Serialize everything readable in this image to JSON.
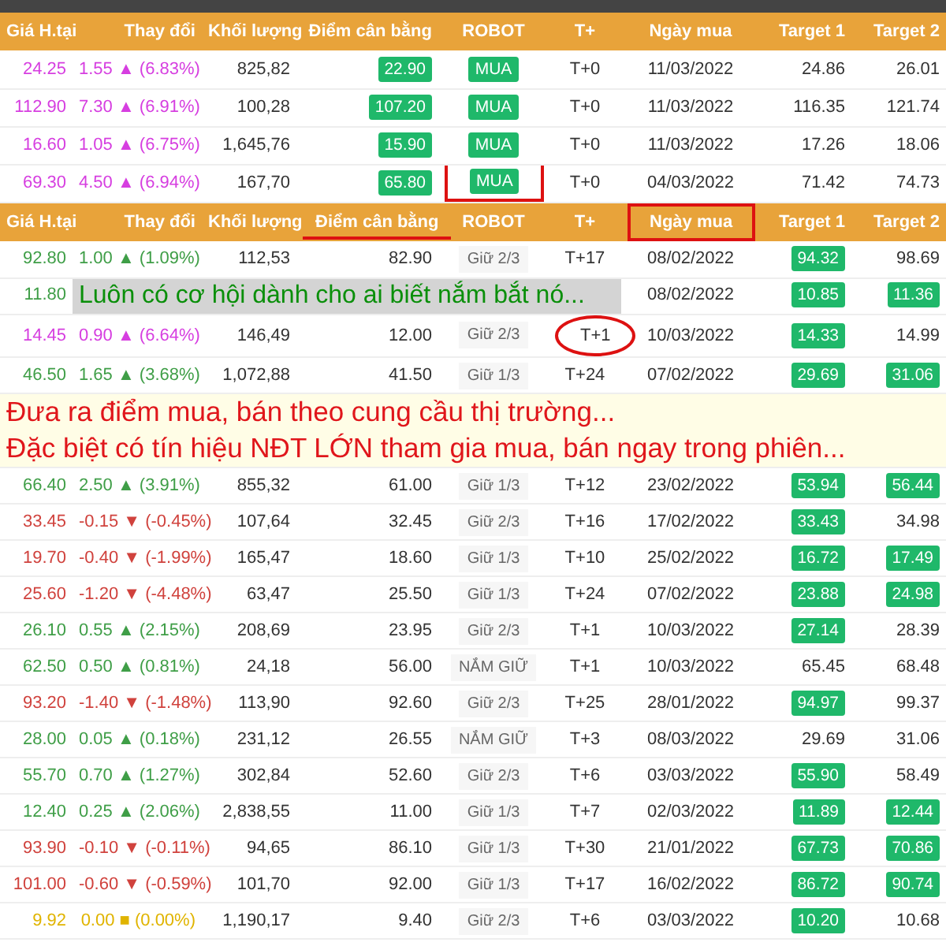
{
  "top_table": {
    "columns": [
      {
        "label": "Giá H.tại",
        "underlined": false,
        "boxed": false
      },
      {
        "label": "Thay đổi",
        "underlined": false,
        "boxed": false
      },
      {
        "label": "Khối lượng",
        "underlined": false,
        "boxed": false
      },
      {
        "label": "Điểm cân bằng",
        "underlined": false,
        "boxed": false
      },
      {
        "label": "ROBOT",
        "underlined": false,
        "boxed": false
      },
      {
        "label": "T+",
        "underlined": false,
        "boxed": false
      },
      {
        "label": "Ngày mua",
        "underlined": false,
        "boxed": false
      },
      {
        "label": "Target 1",
        "underlined": false,
        "boxed": false
      },
      {
        "label": "Target 2",
        "underlined": false,
        "boxed": false
      }
    ],
    "rows": [
      {
        "kind": "stock",
        "color": "#d63ee0",
        "price": "24.25",
        "change": "1.55 ▲ (6.83%)",
        "volume": "825,82",
        "balance": "22.90",
        "balance_hit": true,
        "robot": "MUA",
        "robot_highlighted": true,
        "robot_bracketed": false,
        "tplus": "T+0",
        "tplus_circled": false,
        "date": "11/03/2022",
        "target1": "24.86",
        "target1_hit": false,
        "target2": "26.01",
        "target2_hit": false
      },
      {
        "kind": "stock",
        "color": "#d63ee0",
        "price": "112.90",
        "change": "7.30 ▲ (6.91%)",
        "volume": "100,28",
        "balance": "107.20",
        "balance_hit": true,
        "robot": "MUA",
        "robot_highlighted": true,
        "robot_bracketed": false,
        "tplus": "T+0",
        "tplus_circled": false,
        "date": "11/03/2022",
        "target1": "116.35",
        "target1_hit": false,
        "target2": "121.74",
        "target2_hit": false
      },
      {
        "kind": "stock",
        "color": "#d63ee0",
        "price": "16.60",
        "change": "1.05 ▲ (6.75%)",
        "volume": "1,645,76",
        "balance": "15.90",
        "balance_hit": true,
        "robot": "MUA",
        "robot_highlighted": true,
        "robot_bracketed": false,
        "tplus": "T+0",
        "tplus_circled": false,
        "date": "11/03/2022",
        "target1": "17.26",
        "target1_hit": false,
        "target2": "18.06",
        "target2_hit": false
      },
      {
        "kind": "stock",
        "color": "#d63ee0",
        "price": "69.30",
        "change": "4.50 ▲ (6.94%)",
        "volume": "167,70",
        "balance": "65.80",
        "balance_hit": true,
        "robot": "MUA",
        "robot_highlighted": true,
        "robot_bracketed": true,
        "tplus": "T+0",
        "tplus_circled": false,
        "date": "04/03/2022",
        "target1": "71.42",
        "target1_hit": false,
        "target2": "74.73",
        "target2_hit": false
      }
    ]
  },
  "bottom_table": {
    "columns": [
      {
        "label": "Giá H.tại",
        "underlined": false,
        "boxed": false
      },
      {
        "label": "Thay đổi",
        "underlined": false,
        "boxed": false
      },
      {
        "label": "Khối lượng",
        "underlined": false,
        "boxed": false
      },
      {
        "label": "Điểm cân bằng",
        "underlined": true,
        "boxed": false
      },
      {
        "label": "ROBOT",
        "underlined": false,
        "boxed": false
      },
      {
        "label": "T+",
        "underlined": false,
        "boxed": false
      },
      {
        "label": "Ngày mua",
        "underlined": false,
        "boxed": true
      },
      {
        "label": "Target 1",
        "underlined": false,
        "boxed": false
      },
      {
        "label": "Target 2",
        "underlined": false,
        "boxed": false
      }
    ],
    "rows": [
      {
        "kind": "stock",
        "color": "#3f9e47",
        "price": "92.80",
        "change": "1.00 ▲ (1.09%)",
        "volume": "112,53",
        "balance": "82.90",
        "balance_hit": false,
        "robot": "Giữ 2/3",
        "robot_highlighted": false,
        "robot_bracketed": false,
        "tplus": "T+17",
        "tplus_circled": false,
        "date": "08/02/2022",
        "target1": "94.32",
        "target1_hit": true,
        "target2": "98.69",
        "target2_hit": false
      },
      {
        "kind": "covered",
        "color": "#3f9e47",
        "price": "11.80",
        "note": "Luôn có cơ hội dành cho ai biết nắm bắt nó...",
        "date": "08/02/2022",
        "target1": "10.85",
        "target1_hit": true,
        "target2": "11.36",
        "target2_hit": true
      },
      {
        "kind": "stock",
        "color": "#d63ee0",
        "price": "14.45",
        "change": "0.90 ▲ (6.64%)",
        "volume": "146,49",
        "balance": "12.00",
        "balance_hit": false,
        "robot": "Giữ 2/3",
        "robot_highlighted": false,
        "robot_bracketed": false,
        "tplus": "T+1",
        "tplus_circled": true,
        "date": "10/03/2022",
        "target1": "14.33",
        "target1_hit": true,
        "target2": "14.99",
        "target2_hit": false
      },
      {
        "kind": "stock",
        "color": "#3f9e47",
        "price": "46.50",
        "change": "1.65 ▲ (3.68%)",
        "volume": "1,072,88",
        "balance": "41.50",
        "balance_hit": false,
        "robot": "Giữ 1/3",
        "robot_highlighted": false,
        "robot_bracketed": false,
        "tplus": "T+24",
        "tplus_circled": false,
        "date": "07/02/2022",
        "target1": "29.69",
        "target1_hit": true,
        "target2": "31.06",
        "target2_hit": true
      },
      {
        "kind": "note",
        "lines": [
          "Đưa ra điểm mua, bán theo cung cầu thị trường...",
          "Đặc biệt có tín hiệu NĐT LỚN tham gia mua, bán ngay trong phiên..."
        ]
      },
      {
        "kind": "stock",
        "color": "#3f9e47",
        "price": "66.40",
        "change": "2.50 ▲ (3.91%)",
        "volume": "855,32",
        "balance": "61.00",
        "balance_hit": false,
        "robot": "Giữ 1/3",
        "robot_highlighted": false,
        "robot_bracketed": false,
        "tplus": "T+12",
        "tplus_circled": false,
        "date": "23/02/2022",
        "target1": "53.94",
        "target1_hit": true,
        "target2": "56.44",
        "target2_hit": true
      },
      {
        "kind": "stock",
        "color": "#d0423d",
        "price": "33.45",
        "change": "-0.15 ▼ (-0.45%)",
        "volume": "107,64",
        "balance": "32.45",
        "balance_hit": false,
        "robot": "Giữ 2/3",
        "robot_highlighted": false,
        "robot_bracketed": false,
        "tplus": "T+16",
        "tplus_circled": false,
        "date": "17/02/2022",
        "target1": "33.43",
        "target1_hit": true,
        "target2": "34.98",
        "target2_hit": false
      },
      {
        "kind": "stock",
        "color": "#d0423d",
        "price": "19.70",
        "change": "-0.40 ▼ (-1.99%)",
        "volume": "165,47",
        "balance": "18.60",
        "balance_hit": false,
        "robot": "Giữ 1/3",
        "robot_highlighted": false,
        "robot_bracketed": false,
        "tplus": "T+10",
        "tplus_circled": false,
        "date": "25/02/2022",
        "target1": "16.72",
        "target1_hit": true,
        "target2": "17.49",
        "target2_hit": true
      },
      {
        "kind": "stock",
        "color": "#d0423d",
        "price": "25.60",
        "change": "-1.20 ▼ (-4.48%)",
        "volume": "63,47",
        "balance": "25.50",
        "balance_hit": false,
        "robot": "Giữ 1/3",
        "robot_highlighted": false,
        "robot_bracketed": false,
        "tplus": "T+24",
        "tplus_circled": false,
        "date": "07/02/2022",
        "target1": "23.88",
        "target1_hit": true,
        "target2": "24.98",
        "target2_hit": true
      },
      {
        "kind": "stock",
        "color": "#3f9e47",
        "price": "26.10",
        "change": "0.55 ▲ (2.15%)",
        "volume": "208,69",
        "balance": "23.95",
        "balance_hit": false,
        "robot": "Giữ 2/3",
        "robot_highlighted": false,
        "robot_bracketed": false,
        "tplus": "T+1",
        "tplus_circled": false,
        "date": "10/03/2022",
        "target1": "27.14",
        "target1_hit": true,
        "target2": "28.39",
        "target2_hit": false
      },
      {
        "kind": "stock",
        "color": "#3f9e47",
        "price": "62.50",
        "change": "0.50 ▲ (0.81%)",
        "volume": "24,18",
        "balance": "56.00",
        "balance_hit": false,
        "robot": "NẮM GIỮ",
        "robot_highlighted": false,
        "robot_bracketed": false,
        "tplus": "T+1",
        "tplus_circled": false,
        "date": "10/03/2022",
        "target1": "65.45",
        "target1_hit": false,
        "target2": "68.48",
        "target2_hit": false
      },
      {
        "kind": "stock",
        "color": "#d0423d",
        "price": "93.20",
        "change": "-1.40 ▼ (-1.48%)",
        "volume": "113,90",
        "balance": "92.60",
        "balance_hit": false,
        "robot": "Giữ 2/3",
        "robot_highlighted": false,
        "robot_bracketed": false,
        "tplus": "T+25",
        "tplus_circled": false,
        "date": "28/01/2022",
        "target1": "94.97",
        "target1_hit": true,
        "target2": "99.37",
        "target2_hit": false
      },
      {
        "kind": "stock",
        "color": "#3f9e47",
        "price": "28.00",
        "change": "0.05 ▲ (0.18%)",
        "volume": "231,12",
        "balance": "26.55",
        "balance_hit": false,
        "robot": "NẮM GIỮ",
        "robot_highlighted": false,
        "robot_bracketed": false,
        "tplus": "T+3",
        "tplus_circled": false,
        "date": "08/03/2022",
        "target1": "29.69",
        "target1_hit": false,
        "target2": "31.06",
        "target2_hit": false
      },
      {
        "kind": "stock",
        "color": "#3f9e47",
        "price": "55.70",
        "change": "0.70 ▲ (1.27%)",
        "volume": "302,84",
        "balance": "52.60",
        "balance_hit": false,
        "robot": "Giữ 2/3",
        "robot_highlighted": false,
        "robot_bracketed": false,
        "tplus": "T+6",
        "tplus_circled": false,
        "date": "03/03/2022",
        "target1": "55.90",
        "target1_hit": true,
        "target2": "58.49",
        "target2_hit": false
      },
      {
        "kind": "stock",
        "color": "#3f9e47",
        "price": "12.40",
        "change": "0.25 ▲ (2.06%)",
        "volume": "2,838,55",
        "balance": "11.00",
        "balance_hit": false,
        "robot": "Giữ 1/3",
        "robot_highlighted": false,
        "robot_bracketed": false,
        "tplus": "T+7",
        "tplus_circled": false,
        "date": "02/03/2022",
        "target1": "11.89",
        "target1_hit": true,
        "target2": "12.44",
        "target2_hit": true
      },
      {
        "kind": "stock",
        "color": "#d0423d",
        "price": "93.90",
        "change": "-0.10 ▼ (-0.11%)",
        "volume": "94,65",
        "balance": "86.10",
        "balance_hit": false,
        "robot": "Giữ 1/3",
        "robot_highlighted": false,
        "robot_bracketed": false,
        "tplus": "T+30",
        "tplus_circled": false,
        "date": "21/01/2022",
        "target1": "67.73",
        "target1_hit": true,
        "target2": "70.86",
        "target2_hit": true
      },
      {
        "kind": "stock",
        "color": "#d0423d",
        "price": "101.00",
        "change": "-0.60 ▼ (-0.59%)",
        "volume": "101,70",
        "balance": "92.00",
        "balance_hit": false,
        "robot": "Giữ 1/3",
        "robot_highlighted": false,
        "robot_bracketed": false,
        "tplus": "T+17",
        "tplus_circled": false,
        "date": "16/02/2022",
        "target1": "86.72",
        "target1_hit": true,
        "target2": "90.74",
        "target2_hit": true
      },
      {
        "kind": "stock",
        "color": "#e0b400",
        "price": "9.92",
        "change": "0.00 ■ (0.00%)",
        "volume": "1,190,17",
        "balance": "9.40",
        "balance_hit": false,
        "robot": "Giữ 2/3",
        "robot_highlighted": false,
        "robot_bracketed": false,
        "tplus": "T+6",
        "tplus_circled": false,
        "date": "03/03/2022",
        "target1": "10.20",
        "target1_hit": true,
        "target2": "10.68",
        "target2_hit": false
      }
    ]
  }
}
